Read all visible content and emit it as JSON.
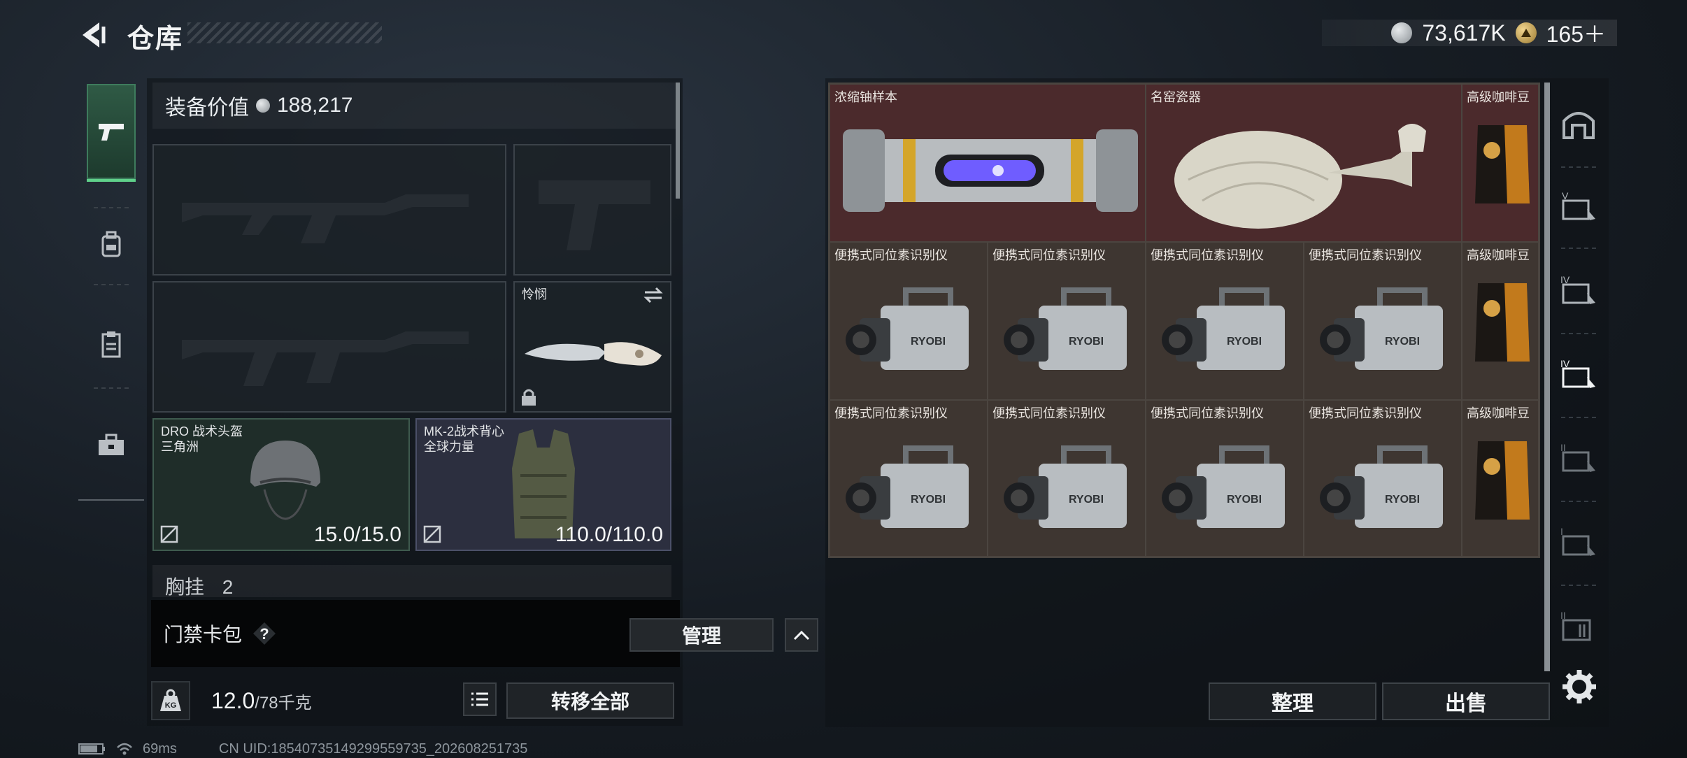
{
  "header": {
    "title": "仓库",
    "currency_silver": "73,617K",
    "currency_gold": "165＋"
  },
  "left_nav": {
    "items": [
      "pistol-icon",
      "backpack-icon",
      "clipboard-icon",
      "toolbox-icon"
    ],
    "active_index": 0
  },
  "equipment": {
    "value_label": "装备价值",
    "value": "188,217",
    "slots": {
      "primary_weapon_1": {
        "label": "",
        "icon": "assault-rifle-silhouette"
      },
      "sidearm": {
        "label": "",
        "icon": "pistol-silhouette"
      },
      "primary_weapon_2": {
        "label": "",
        "icon": "assault-rifle-silhouette"
      },
      "melee": {
        "label": "怜悯",
        "icon": "knife-icon",
        "locked": true
      },
      "helmet": {
        "name": "DRO 战术头盔",
        "brand": "三角洲",
        "durability": "15.0/15.0"
      },
      "vest": {
        "name": "MK-2战术背心",
        "brand": "全球力量",
        "durability": "110.0/110.0"
      }
    },
    "chest_rig_label": "胸挂",
    "chest_rig_extra": "2"
  },
  "keycard": {
    "label": "门禁卡包",
    "help": "?",
    "manage_label": "管理"
  },
  "weight": {
    "icon_text": "KG",
    "current": "12.0",
    "max": "/78千克",
    "transfer_all_label": "转移全部"
  },
  "storage": {
    "items": {
      "uranium": "浓缩铀样本",
      "vase": "名窑瓷器",
      "coffee_1": "高级咖啡豆",
      "coffee_2": "高级咖啡豆",
      "coffee_3": "高级咖啡豆",
      "isotope": "便携式同位素识别仪"
    },
    "isotope_brand": "RYOBI",
    "sort_label": "整理",
    "sell_label": "出售"
  },
  "side_tabs": [
    "vault-icon",
    "tier-v-case-icon",
    "tier-iv-case-icon",
    "tier-iv-case-active-icon",
    "tier-ii-case-icon",
    "tier-i-case-icon",
    "tier-ii-box-icon"
  ],
  "status": {
    "ping": "69ms",
    "uid": "CN UID:185407351492995597​35_202608251735"
  },
  "colors": {
    "accent_green": "#5fd08a",
    "valuable_red_bg": "#4b2a2c",
    "common_brown_bg": "#3e3631"
  }
}
